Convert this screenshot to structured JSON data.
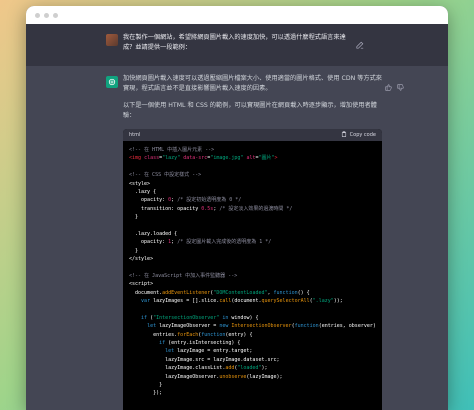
{
  "user_message": {
    "text": "我在製作一個網站，希望將網頁圖片載入的速度加快，可以透過什麼程式語言來達成？並請提供一段範例："
  },
  "assistant_message": {
    "paragraph1": "加快網頁圖片載入速度可以透過壓縮圖片檔案大小、使用適當的圖片格式、使用 CDN 等方式來實現，程式語言並不是直接影響圖片載入速度的因素。",
    "paragraph2": "以下是一個使用 HTML 和 CSS 的範例，可以實現圖片在網頁載入時逐步顯示，增加使用者體驗："
  },
  "code_block": {
    "language": "html",
    "copy_label": "Copy code",
    "lines": [
      [
        {
          "t": "<!-- 在 HTML 中插入圖片元素 -->",
          "c": "com"
        }
      ],
      [
        {
          "t": "<img ",
          "c": "tag"
        },
        {
          "t": "class",
          "c": "attr"
        },
        {
          "t": "=",
          "c": "var"
        },
        {
          "t": "\"lazy\"",
          "c": "str"
        },
        {
          "t": " data-src",
          "c": "attr"
        },
        {
          "t": "=",
          "c": "var"
        },
        {
          "t": "\"image.jpg\"",
          "c": "str"
        },
        {
          "t": " alt",
          "c": "attr"
        },
        {
          "t": "=",
          "c": "var"
        },
        {
          "t": "\"圖片\"",
          "c": "str"
        },
        {
          "t": ">",
          "c": "tag"
        }
      ],
      [
        {
          "t": "",
          "c": "var"
        }
      ],
      [
        {
          "t": "<!-- 在 CSS 中設定樣式 -->",
          "c": "com"
        }
      ],
      [
        {
          "t": "<style>",
          "c": "var"
        }
      ],
      [
        {
          "t": "  .lazy {",
          "c": "var"
        }
      ],
      [
        {
          "t": "    opacity",
          "c": "var"
        },
        {
          "t": ": ",
          "c": "var"
        },
        {
          "t": "0",
          "c": "num"
        },
        {
          "t": "; ",
          "c": "var"
        },
        {
          "t": "/* 設定初始透明度為 0 */",
          "c": "com"
        }
      ],
      [
        {
          "t": "    transition",
          "c": "var"
        },
        {
          "t": ": opacity ",
          "c": "var"
        },
        {
          "t": "0.5s",
          "c": "num"
        },
        {
          "t": "; ",
          "c": "var"
        },
        {
          "t": "/* 設定淡入效果的過渡時間 */",
          "c": "com"
        }
      ],
      [
        {
          "t": "  }",
          "c": "var"
        }
      ],
      [
        {
          "t": "",
          "c": "var"
        }
      ],
      [
        {
          "t": "  .lazy.loaded {",
          "c": "var"
        }
      ],
      [
        {
          "t": "    opacity",
          "c": "var"
        },
        {
          "t": ": ",
          "c": "var"
        },
        {
          "t": "1",
          "c": "num"
        },
        {
          "t": "; ",
          "c": "var"
        },
        {
          "t": "/* 設定圖片載入完成後的透明度為 1 */",
          "c": "com"
        }
      ],
      [
        {
          "t": "  }",
          "c": "var"
        }
      ],
      [
        {
          "t": "</style>",
          "c": "var"
        }
      ],
      [
        {
          "t": "",
          "c": "var"
        }
      ],
      [
        {
          "t": "<!-- 在 JavaScript 中加入事件監聽器 -->",
          "c": "com"
        }
      ],
      [
        {
          "t": "<script>",
          "c": "var"
        }
      ],
      [
        {
          "t": "  document.",
          "c": "var"
        },
        {
          "t": "addEventListener",
          "c": "fn"
        },
        {
          "t": "(",
          "c": "var"
        },
        {
          "t": "\"DOMContentLoaded\"",
          "c": "str"
        },
        {
          "t": ", ",
          "c": "var"
        },
        {
          "t": "function",
          "c": "kw"
        },
        {
          "t": "() {",
          "c": "var"
        }
      ],
      [
        {
          "t": "    ",
          "c": "var"
        },
        {
          "t": "var",
          "c": "kw"
        },
        {
          "t": " lazyImages = [].slice.",
          "c": "var"
        },
        {
          "t": "call",
          "c": "fn"
        },
        {
          "t": "(document.",
          "c": "var"
        },
        {
          "t": "querySelectorAll",
          "c": "fn"
        },
        {
          "t": "(",
          "c": "var"
        },
        {
          "t": "\".lazy\"",
          "c": "str"
        },
        {
          "t": "));",
          "c": "var"
        }
      ],
      [
        {
          "t": "",
          "c": "var"
        }
      ],
      [
        {
          "t": "    ",
          "c": "var"
        },
        {
          "t": "if",
          "c": "kw"
        },
        {
          "t": " (",
          "c": "var"
        },
        {
          "t": "\"IntersectionObserver\"",
          "c": "str"
        },
        {
          "t": " ",
          "c": "var"
        },
        {
          "t": "in",
          "c": "kw"
        },
        {
          "t": " window) {",
          "c": "var"
        }
      ],
      [
        {
          "t": "      ",
          "c": "var"
        },
        {
          "t": "let",
          "c": "kw"
        },
        {
          "t": " lazyImageObserver = ",
          "c": "var"
        },
        {
          "t": "new",
          "c": "kw"
        },
        {
          "t": " ",
          "c": "var"
        },
        {
          "t": "IntersectionObserver",
          "c": "fn"
        },
        {
          "t": "(",
          "c": "var"
        },
        {
          "t": "function",
          "c": "kw"
        },
        {
          "t": "(entries, observer)",
          "c": "var"
        }
      ],
      [
        {
          "t": "        entries.",
          "c": "var"
        },
        {
          "t": "forEach",
          "c": "fn"
        },
        {
          "t": "(",
          "c": "var"
        },
        {
          "t": "function",
          "c": "kw"
        },
        {
          "t": "(entry) {",
          "c": "var"
        }
      ],
      [
        {
          "t": "          ",
          "c": "var"
        },
        {
          "t": "if",
          "c": "kw"
        },
        {
          "t": " (entry.isIntersecting) {",
          "c": "var"
        }
      ],
      [
        {
          "t": "            ",
          "c": "var"
        },
        {
          "t": "let",
          "c": "kw"
        },
        {
          "t": " lazyImage = entry.target;",
          "c": "var"
        }
      ],
      [
        {
          "t": "            lazyImage.src = lazyImage.dataset.src;",
          "c": "var"
        }
      ],
      [
        {
          "t": "            lazyImage.classList.",
          "c": "var"
        },
        {
          "t": "add",
          "c": "fn"
        },
        {
          "t": "(",
          "c": "var"
        },
        {
          "t": "\"loaded\"",
          "c": "str"
        },
        {
          "t": ");",
          "c": "var"
        }
      ],
      [
        {
          "t": "            lazyImageObserver.",
          "c": "var"
        },
        {
          "t": "unobserve",
          "c": "fn"
        },
        {
          "t": "(lazyImage);",
          "c": "var"
        }
      ],
      [
        {
          "t": "          }",
          "c": "var"
        }
      ],
      [
        {
          "t": "        });",
          "c": "var"
        }
      ]
    ]
  },
  "icons": {
    "edit": "edit-icon",
    "thumbs_up": "thumbs-up-icon",
    "thumbs_down": "thumbs-down-icon",
    "copy": "clipboard-icon",
    "bot_avatar": "openai-logo-icon"
  },
  "colors": {
    "bot_avatar": "#10a37f",
    "user_row": "#343541",
    "bot_row": "#444654",
    "code_bg": "#000000"
  }
}
